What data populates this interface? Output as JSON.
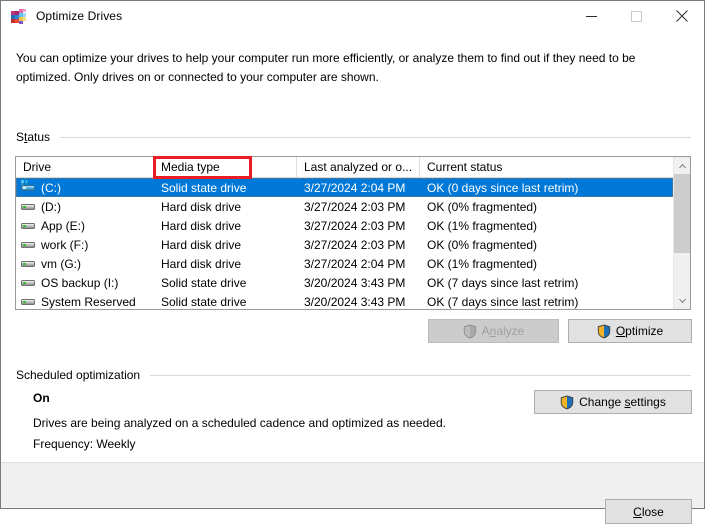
{
  "window": {
    "title": "Optimize Drives",
    "icon": "defrag-icon",
    "controls": {
      "minimize": "minimize-icon",
      "maximize": "maximize-icon",
      "close": "close-icon"
    }
  },
  "intro": "You can optimize your drives to help your computer run more efficiently, or analyze them to find out if they need to be optimized. Only drives on or connected to your computer are shown.",
  "status_section": {
    "label_prefix": "S",
    "label_accel": "t",
    "label_suffix": "atus",
    "label_full": "Status"
  },
  "table": {
    "columns": [
      {
        "key": "drive",
        "label": "Drive"
      },
      {
        "key": "media",
        "label": "Media type"
      },
      {
        "key": "last",
        "label": "Last analyzed or o..."
      },
      {
        "key": "status",
        "label": "Current status"
      }
    ],
    "rows": [
      {
        "drive": "(C:)",
        "media": "Solid state drive",
        "last": "3/27/2024 2:04 PM",
        "status": "OK (0 days since last retrim)",
        "icon": "system-drive-icon",
        "selected": true
      },
      {
        "drive": "(D:)",
        "media": "Hard disk drive",
        "last": "3/27/2024 2:03 PM",
        "status": "OK (0% fragmented)",
        "icon": "drive-icon",
        "selected": false
      },
      {
        "drive": "App (E:)",
        "media": "Hard disk drive",
        "last": "3/27/2024 2:03 PM",
        "status": "OK (1% fragmented)",
        "icon": "drive-icon",
        "selected": false
      },
      {
        "drive": "work (F:)",
        "media": "Hard disk drive",
        "last": "3/27/2024 2:03 PM",
        "status": "OK (0% fragmented)",
        "icon": "drive-icon",
        "selected": false
      },
      {
        "drive": "vm (G:)",
        "media": "Hard disk drive",
        "last": "3/27/2024 2:04 PM",
        "status": "OK (1% fragmented)",
        "icon": "drive-icon",
        "selected": false
      },
      {
        "drive": "OS backup (I:)",
        "media": "Solid state drive",
        "last": "3/20/2024 3:43 PM",
        "status": "OK (7 days since last retrim)",
        "icon": "drive-icon",
        "selected": false
      },
      {
        "drive": "System Reserved",
        "media": "Solid state drive",
        "last": "3/20/2024 3:43 PM",
        "status": "OK (7 days since last retrim)",
        "icon": "drive-icon",
        "selected": false
      }
    ],
    "scrollbar": {
      "up": "chevron-up-icon",
      "down": "chevron-down-icon",
      "thumb_fraction": "67%"
    }
  },
  "buttons": {
    "analyze": {
      "prefix": "A",
      "accel": "n",
      "suffix": "alyze",
      "label": "Analyze",
      "enabled": false,
      "icon": "uac-shield-icon"
    },
    "optimize": {
      "prefix": "",
      "accel": "O",
      "suffix": "ptimize",
      "label": "Optimize",
      "enabled": true,
      "icon": "uac-shield-icon"
    },
    "change": {
      "prefix": "Change ",
      "accel": "s",
      "suffix": "ettings",
      "label": "Change settings",
      "enabled": true,
      "icon": "uac-shield-icon"
    },
    "close": {
      "prefix": "",
      "accel": "C",
      "suffix": "lose",
      "label": "Close",
      "enabled": true,
      "icon": null
    }
  },
  "scheduled_section": {
    "heading": "Scheduled optimization",
    "state": "On",
    "description": "Drives are being analyzed on a scheduled cadence and optimized as needed.",
    "frequency": "Frequency: Weekly"
  },
  "annotation": {
    "type": "red-rectangle-highlight",
    "target": "Media type",
    "color": "#ec1c24"
  }
}
